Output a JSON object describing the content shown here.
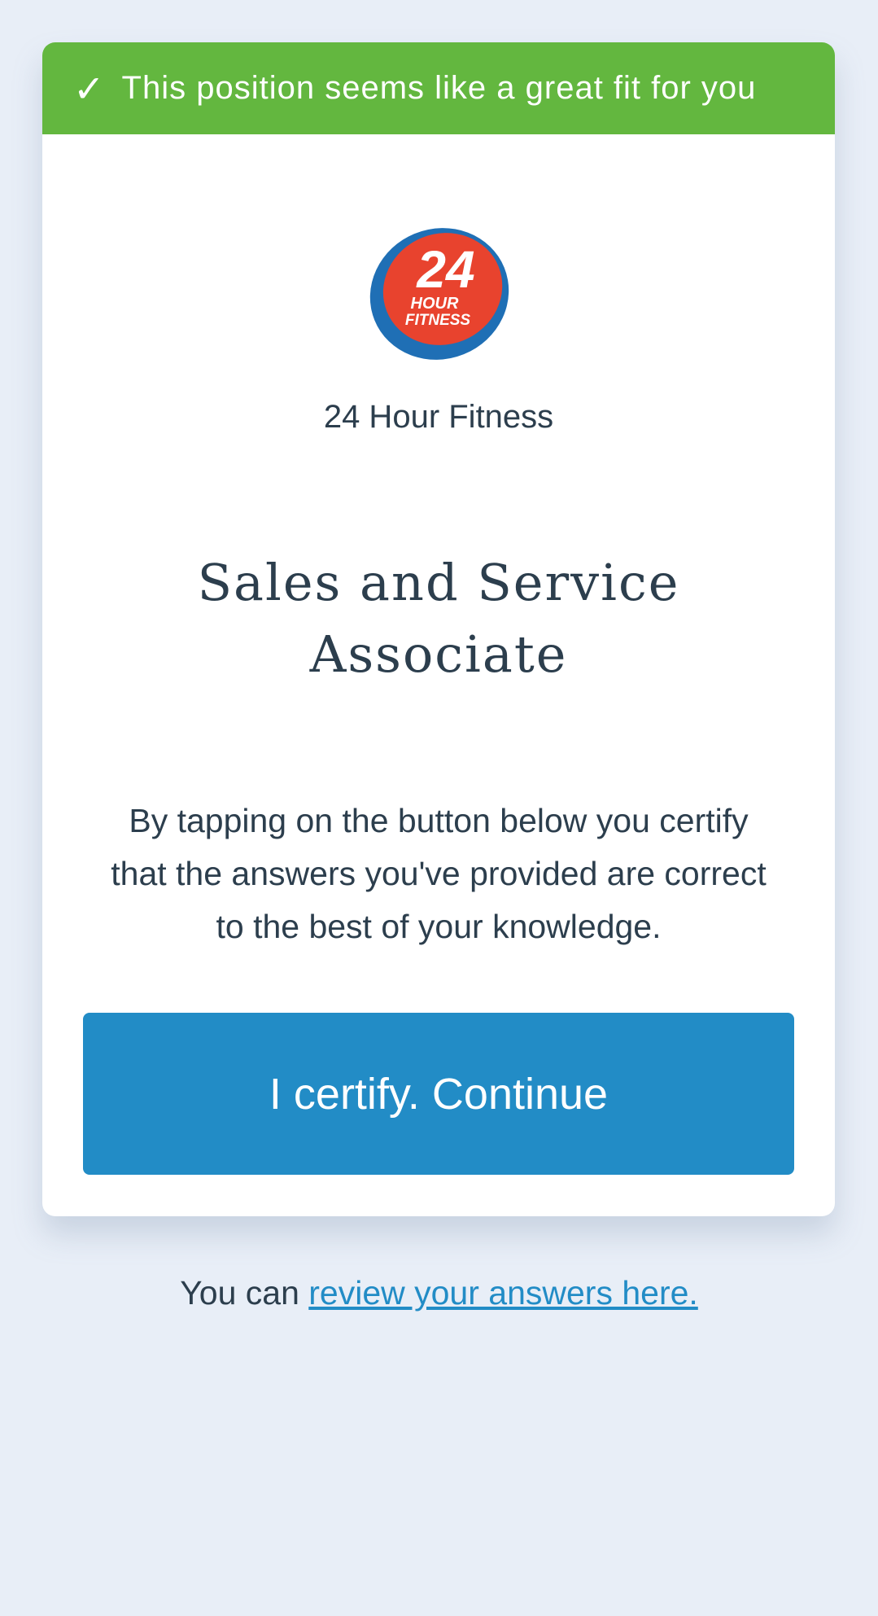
{
  "banner": {
    "check_glyph": "✓",
    "text": "This position seems like a great fit for you"
  },
  "company": {
    "logo_icon": "24-hour-fitness-logo",
    "logo_text_number": "24",
    "logo_text_line1": "HOUR",
    "logo_text_line2": "FITNESS",
    "logo_registered": "®",
    "name": "24 Hour Fitness"
  },
  "job": {
    "title": "Sales and Service Associate"
  },
  "certification": {
    "text": "By tapping on the button below you certify that the answers you've provided are correct to the best of your knowledge.",
    "button_label": "I certify. Continue"
  },
  "review": {
    "prefix": "You can ",
    "link_text": "review your answers here."
  },
  "colors": {
    "background": "#e8eef7",
    "banner": "#63b73f",
    "button": "#228cc6",
    "link": "#228cc6",
    "text": "#2c3e4d",
    "logo_blue": "#1f6fb5",
    "logo_red": "#e8432e"
  }
}
